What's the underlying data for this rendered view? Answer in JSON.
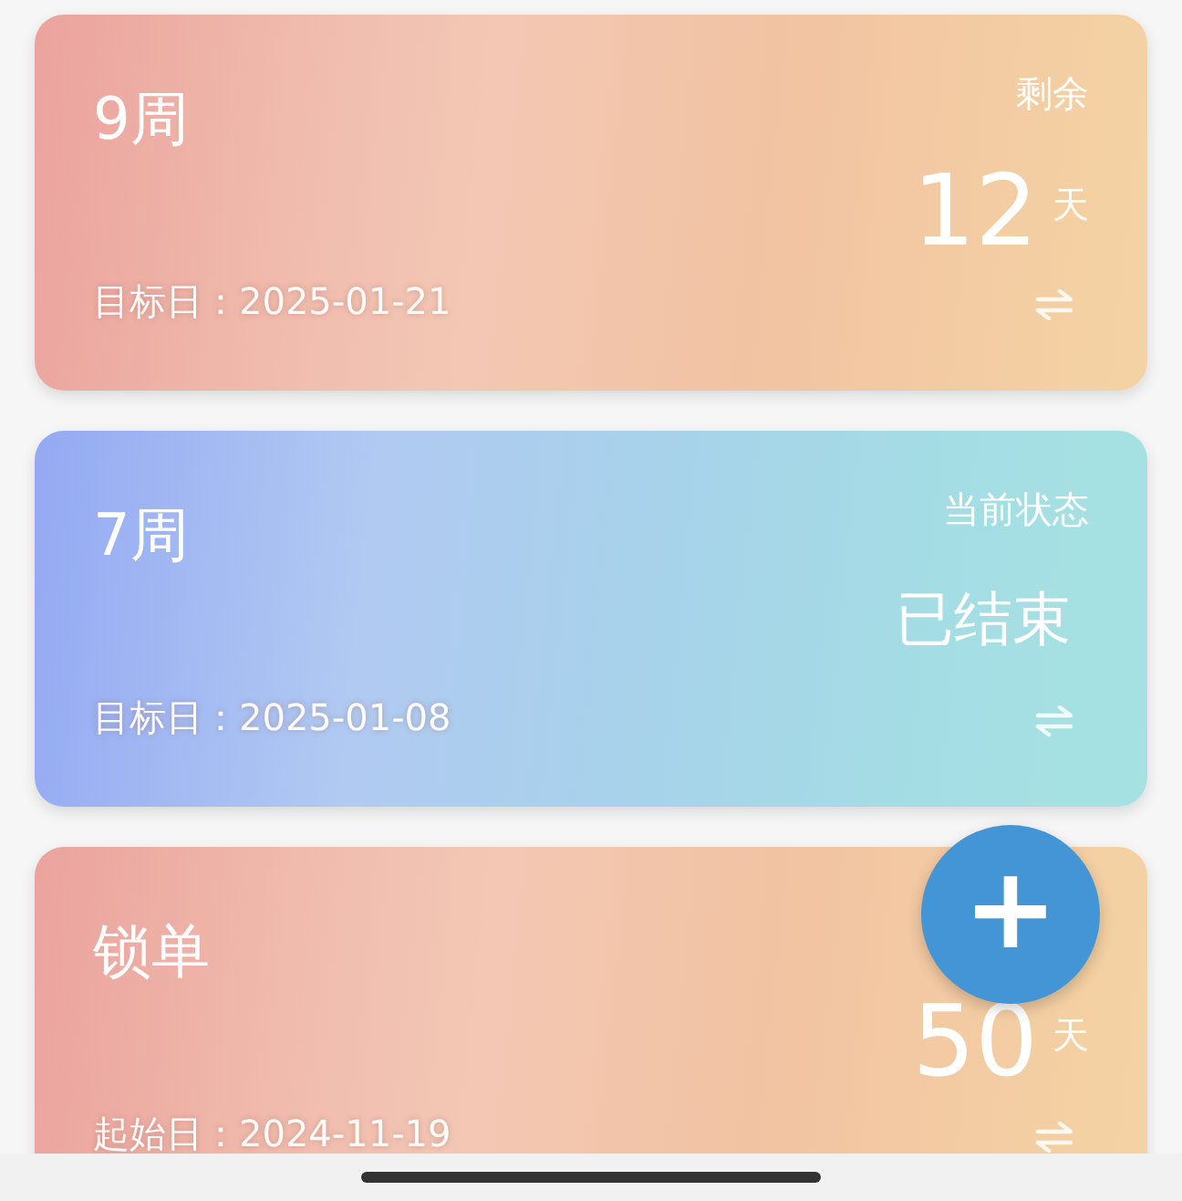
{
  "cards": [
    {
      "title": "9周",
      "kind": "warm",
      "label": "剩余",
      "value": "12",
      "unit": "天",
      "date": "目标日：2025-01-21"
    },
    {
      "title": "7周",
      "kind": "cool",
      "label": "当前状态",
      "value": "已结束",
      "date": "目标日：2025-01-08"
    },
    {
      "title": "锁单",
      "kind": "warm",
      "value": "50",
      "unit": "天",
      "date": "起始日：2024-11-19"
    }
  ],
  "fab": {
    "label": "+"
  }
}
